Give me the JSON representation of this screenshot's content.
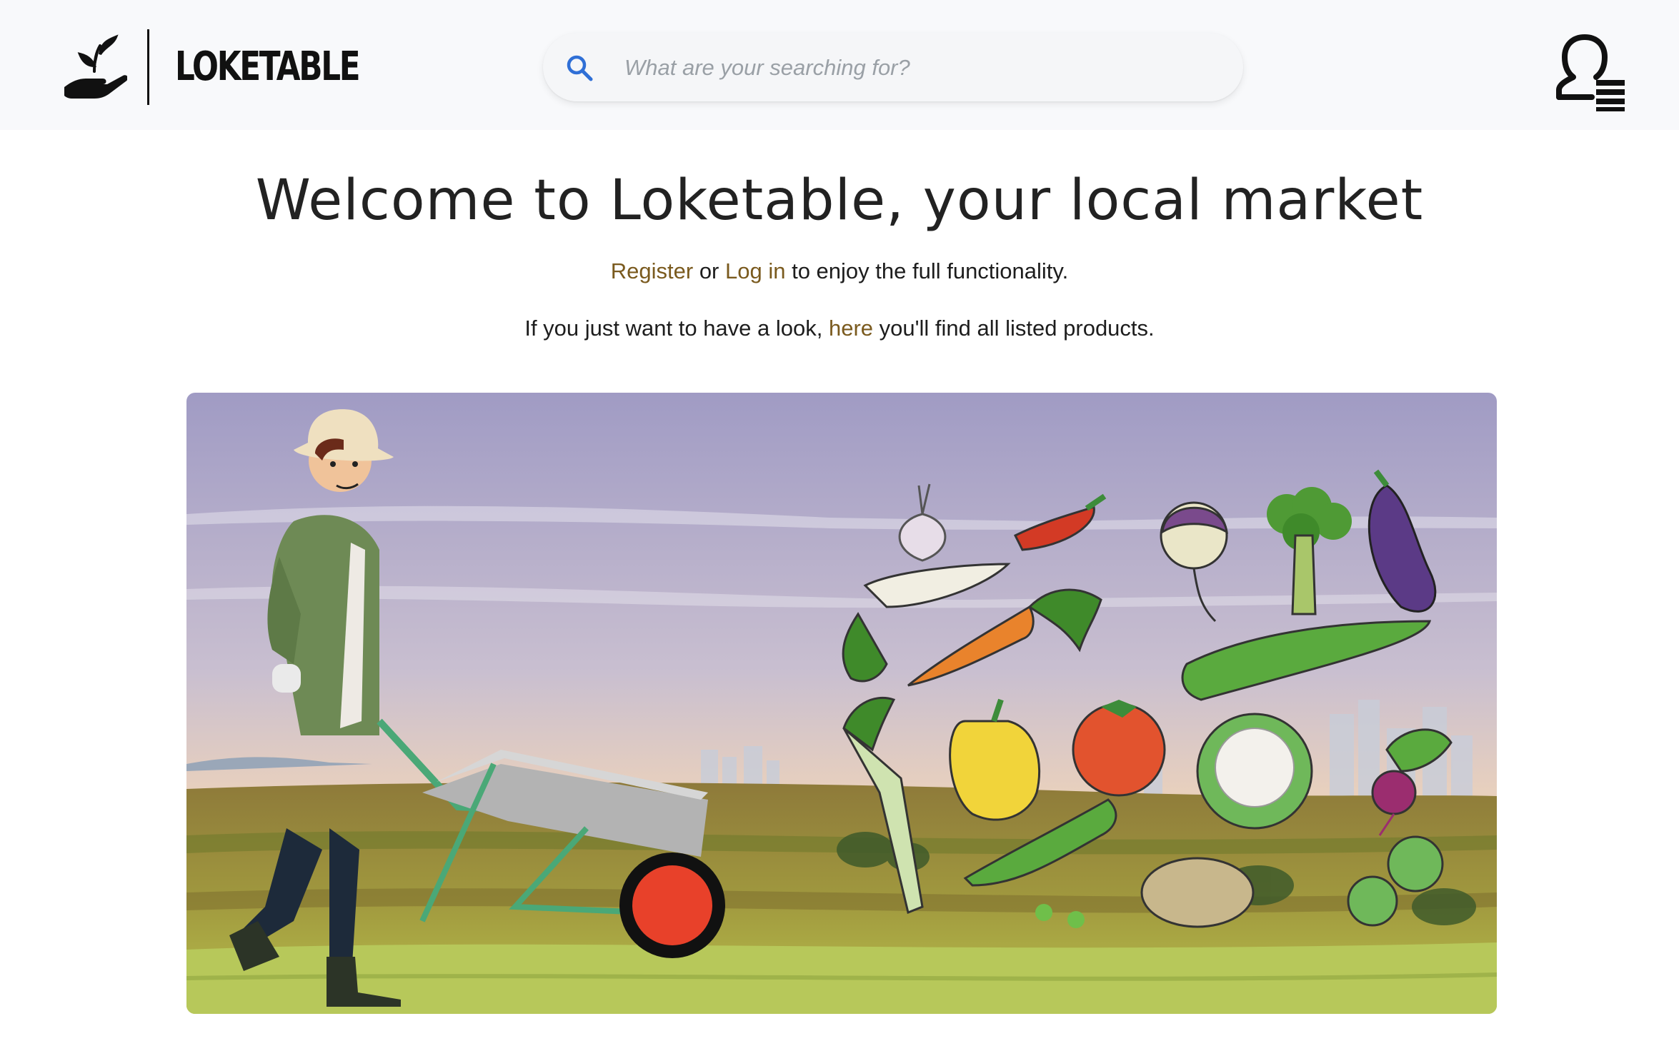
{
  "brand": {
    "name": "LOKETABLE",
    "logo_icon": "hand-sprout-icon"
  },
  "search": {
    "placeholder": "What are your searching for?",
    "value": "",
    "icon": "search-icon"
  },
  "user_menu": {
    "icon": "user-menu-icon"
  },
  "main": {
    "title": "Welcome to Loketable, your local market",
    "line1": {
      "register": "Register",
      "or": " or ",
      "login": "Log in",
      "rest": " to enjoy the full functionality."
    },
    "line2": {
      "before": "If you just want to have a look, ",
      "here": "here",
      "after": " you'll find all listed products."
    }
  },
  "hero": {
    "image": "farmer-with-wheelbarrow-and-vegetables-illustration"
  },
  "colors": {
    "link": "#7a5a1e",
    "header_bg": "#f8f9fb",
    "search_icon": "#2f6fd6",
    "text": "#1d1d1d"
  }
}
